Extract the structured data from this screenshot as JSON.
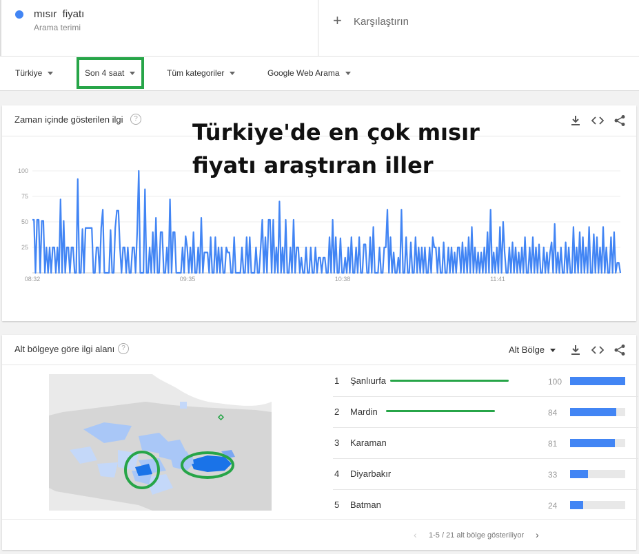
{
  "search_term": {
    "name": "mısır  fiyatı",
    "type": "Arama terimi",
    "dot_color": "#4285f4"
  },
  "compare": {
    "label": "Karşılaştırın"
  },
  "filters": {
    "region": "Türkiye",
    "time": "Son 4 saat",
    "category": "Tüm kategoriler",
    "search_type": "Google Web Arama"
  },
  "interest_over_time": {
    "title": "Zaman içinde gösterilen ilgi"
  },
  "overlay_text": {
    "line1": "Türkiye'de en çok mısır",
    "line2": "fiyatı araştıran iller"
  },
  "chart_data": {
    "type": "line",
    "x_ticks": [
      "08:32",
      "09:35",
      "10:38",
      "11:41"
    ],
    "y_ticks": [
      100,
      75,
      50,
      25
    ],
    "ylim": [
      0,
      100
    ],
    "grid": true,
    "series": [
      {
        "color": "#4285f4",
        "values": [
          52,
          52,
          0,
          52,
          52,
          0,
          51,
          51,
          0,
          25,
          0,
          25,
          0,
          25,
          25,
          0,
          25,
          0,
          72,
          0,
          51,
          0,
          25,
          25,
          0,
          25,
          25,
          0,
          0,
          92,
          0,
          0,
          43,
          0,
          44,
          44,
          44,
          44,
          44,
          0,
          0,
          25,
          25,
          0,
          44,
          62,
          0,
          0,
          0,
          0,
          42,
          0,
          0,
          44,
          61,
          61,
          25,
          0,
          25,
          25,
          0,
          25,
          0,
          0,
          25,
          25,
          0,
          40,
          100,
          0,
          0,
          0,
          82,
          0,
          0,
          25,
          0,
          40,
          0,
          54,
          0,
          0,
          40,
          40,
          0,
          0,
          25,
          0,
          72,
          0,
          40,
          40,
          0,
          0,
          0,
          0,
          25,
          0,
          36,
          25,
          0,
          25,
          0,
          40,
          0,
          0,
          25,
          0,
          54,
          0,
          20,
          20,
          20,
          0,
          35,
          0,
          0,
          35,
          0,
          25,
          0,
          25,
          0,
          0,
          25,
          20,
          20,
          0,
          0,
          35,
          0,
          0,
          0,
          0,
          25,
          0,
          0,
          35,
          0,
          35,
          0,
          0,
          0,
          25,
          0,
          0,
          25,
          52,
          0,
          35,
          0,
          52,
          52,
          0,
          52,
          0,
          25,
          0,
          70,
          0,
          25,
          0,
          52,
          0,
          0,
          25,
          0,
          52,
          0,
          25,
          25,
          0,
          15,
          0,
          0,
          25,
          0,
          0,
          25,
          0,
          0,
          25,
          0,
          15,
          15,
          0,
          15,
          15,
          0,
          0,
          35,
          0,
          52,
          0,
          35,
          0,
          0,
          34,
          0,
          0,
          15,
          0,
          25,
          0,
          35,
          0,
          0,
          25,
          0,
          35,
          0,
          0,
          28,
          28,
          0,
          0,
          35,
          0,
          45,
          0,
          0,
          0,
          25,
          0,
          0,
          25,
          25,
          62,
          0,
          35,
          0,
          20,
          0,
          0,
          15,
          0,
          62,
          0,
          0,
          35,
          0,
          0,
          30,
          0,
          0,
          35,
          0,
          25,
          0,
          25,
          0,
          25,
          0,
          0,
          25,
          0,
          35,
          25,
          25,
          0,
          25,
          0,
          0,
          30,
          0,
          0,
          25,
          0,
          25,
          0,
          20,
          0,
          25,
          25,
          0,
          30,
          0,
          25,
          0,
          35,
          0,
          45,
          0,
          25,
          0,
          20,
          0,
          20,
          0,
          25,
          0,
          40,
          0,
          62,
          0,
          20,
          0,
          25,
          0,
          45,
          0,
          50,
          20,
          0,
          0,
          25,
          0,
          30,
          0,
          25,
          0,
          20,
          0,
          25,
          0,
          35,
          0,
          0,
          25,
          0,
          35,
          0,
          25,
          0,
          28,
          0,
          0,
          25,
          0,
          20,
          0,
          20,
          30,
          0,
          48,
          0,
          20,
          0,
          25,
          0,
          0,
          30,
          0,
          25,
          0,
          0,
          45,
          0,
          25,
          0,
          40,
          0,
          35,
          0,
          25,
          0,
          45,
          0,
          0,
          38,
          0,
          35,
          0,
          25,
          0,
          45,
          0,
          25,
          0,
          0,
          35,
          0,
          40,
          0,
          10,
          10,
          0
        ]
      }
    ]
  },
  "interest_by_region": {
    "title": "Alt bölgeye göre ilgi alanı",
    "dropdown": "Alt Bölge",
    "pagination": "1-5 / 21 alt bölge gösteriliyor",
    "bar_color": "#4285f4",
    "rows": [
      {
        "rank": "1",
        "name": "Şanlıurfa",
        "value": "100",
        "fraction": 1.0
      },
      {
        "rank": "2",
        "name": "Mardin",
        "value": "84",
        "fraction": 0.84
      },
      {
        "rank": "3",
        "name": "Karaman",
        "value": "81",
        "fraction": 0.81
      },
      {
        "rank": "4",
        "name": "Diyarbakır",
        "value": "33",
        "fraction": 0.33
      },
      {
        "rank": "5",
        "name": "Batman",
        "value": "24",
        "fraction": 0.24
      }
    ]
  },
  "icons": [
    "download-icon",
    "embed-icon",
    "share-icon",
    "help-icon",
    "plus-icon",
    "chevron-left-icon",
    "chevron-right-icon",
    "dropdown-caret-icon"
  ],
  "highlight_color": "#27a548"
}
